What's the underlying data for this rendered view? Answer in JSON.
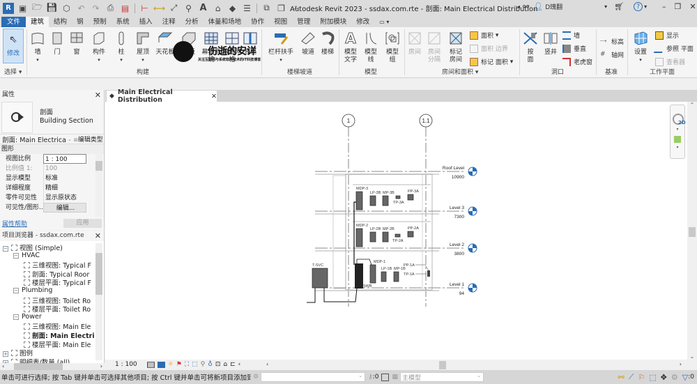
{
  "titlebar": {
    "title": "Autodesk Revit 2023 - ssdax.com.rte - 剖面: Main Electrical Distribution",
    "user": "D瑰翻",
    "help": "?",
    "app_icon": "R",
    "app_year": "2023",
    "quick_access_icons": [
      "open-icon",
      "save-icon",
      "sync-icon",
      "undo-icon",
      "redo-icon",
      "print-icon",
      "export-icon",
      "measure-icon",
      "aligned-dimension-icon",
      "tag-icon",
      "text-icon",
      "3d-view-icon",
      "section-icon",
      "thin-lines-icon",
      "close-hidden-icon",
      "switch-windows-icon"
    ]
  },
  "ribbon_tabs": [
    "文件",
    "建筑",
    "结构",
    "钢",
    "预制",
    "系统",
    "插入",
    "注释",
    "分析",
    "体量和场地",
    "协作",
    "视图",
    "管理",
    "附加模块",
    "修改"
  ],
  "ribbon": {
    "select": {
      "modify": "修改",
      "panel": "选择"
    },
    "build": {
      "panel": "构建",
      "buttons": [
        "墙",
        "门",
        "窗",
        "构件",
        "柱",
        "屋顶",
        "天花板",
        "楼板",
        "幕墙系统",
        "幕墙网格",
        "竖梃"
      ]
    },
    "circulation": {
      "panel": "楼梯坡道",
      "buttons": [
        "栏杆扶手",
        "坡道",
        "楼梯"
      ]
    },
    "model": {
      "panel": "模型",
      "buttons": [
        "模型文字",
        "模型线",
        "模型组"
      ]
    },
    "room": {
      "panel": "房间和面积",
      "buttons": [
        "房间",
        "房间分隔",
        "标记房间"
      ],
      "small": [
        "面积",
        "面积 边界",
        "标记 面积"
      ]
    },
    "opening": {
      "panel": "洞口",
      "buttons": [
        "按面",
        "竖井"
      ],
      "small": [
        "墙",
        "垂直",
        "老虎窗"
      ]
    },
    "datum": {
      "panel": "基准",
      "small": [
        "标高",
        "轴网"
      ]
    },
    "workplane": {
      "panel": "工作平面",
      "buttons": [
        "设置"
      ],
      "small": [
        "显示",
        "参照 平面",
        "查看器"
      ]
    },
    "watermark": {
      "title": "伤逝的安详",
      "subtitle": "关注互联网与系统软件技术的IT科技博客"
    }
  },
  "properties": {
    "title": "属性",
    "type_name": "剖面",
    "type_family": "Building Section",
    "selector": "剖面: Main Electrica",
    "edit_type": "编辑类型",
    "group": "图形",
    "rows": [
      {
        "key": "视图比例",
        "value": "1 : 100"
      },
      {
        "key": "比例值 1:",
        "value": "100"
      },
      {
        "key": "显示模型",
        "value": "标准"
      },
      {
        "key": "详细程度",
        "value": "精细"
      },
      {
        "key": "零件可见性",
        "value": "显示原状态"
      },
      {
        "key": "可见性/图形...",
        "value": "编辑..."
      }
    ],
    "help_link": "属性帮助",
    "apply": "应用"
  },
  "browser": {
    "title": "项目浏览器 - ssdax.com.rte",
    "items": [
      {
        "label": "视图 (Simple)",
        "level": 0,
        "toggle": "−"
      },
      {
        "label": "HVAC",
        "level": 1,
        "toggle": "−"
      },
      {
        "label": "三维视图: Typical F",
        "level": 2
      },
      {
        "label": "剖面: Typical Roor",
        "level": 2
      },
      {
        "label": "楼层平面: Typical F",
        "level": 2
      },
      {
        "label": "Plumbing",
        "level": 1,
        "toggle": "−"
      },
      {
        "label": "三维视图: Toilet Ro",
        "level": 2
      },
      {
        "label": "楼层平面: Toilet Ro",
        "level": 2
      },
      {
        "label": "Power",
        "level": 1,
        "toggle": "−"
      },
      {
        "label": "三维视图: Main Ele",
        "level": 2
      },
      {
        "label": "剖面: Main Electri",
        "level": 2,
        "bold": true
      },
      {
        "label": "楼层平面: Main Ele",
        "level": 2
      },
      {
        "label": "图例",
        "level": 0,
        "toggle": "+"
      },
      {
        "label": "明细表/数量 (all)",
        "level": 0,
        "toggle": "+"
      }
    ]
  },
  "view": {
    "tab_title": "Main Electrical Distribution",
    "grids": [
      "1",
      "1.1"
    ],
    "levels": [
      {
        "name": "Roof Level",
        "elev": "10900"
      },
      {
        "name": "Level 3",
        "elev": "7300"
      },
      {
        "name": "Level 2",
        "elev": "3800"
      },
      {
        "name": "Level 1",
        "elev": "94"
      }
    ],
    "equipment": [
      "MDP-3",
      "LP-3B",
      "MP-3B",
      "TP-3A",
      "PP-3A",
      "MDP-2",
      "LP-2B",
      "MP-2B",
      "TP-2A",
      "PP-2A",
      "MDP-1",
      "LP-1B",
      "MP-1B",
      "PP-1A",
      "TP-1A",
      "T-SVC",
      "SWB"
    ],
    "nav_bar": {
      "wheel": "2D"
    }
  },
  "view_control": {
    "scale": "1 : 100"
  },
  "status": {
    "message": "单击可进行选择; 按 Tab 键并单击可选择其他项目; 按 Ctrl 键并单击可将新项目添加到选择集",
    "workset_count": ":0",
    "design_option": "主模型",
    "filter_count": ":0"
  }
}
